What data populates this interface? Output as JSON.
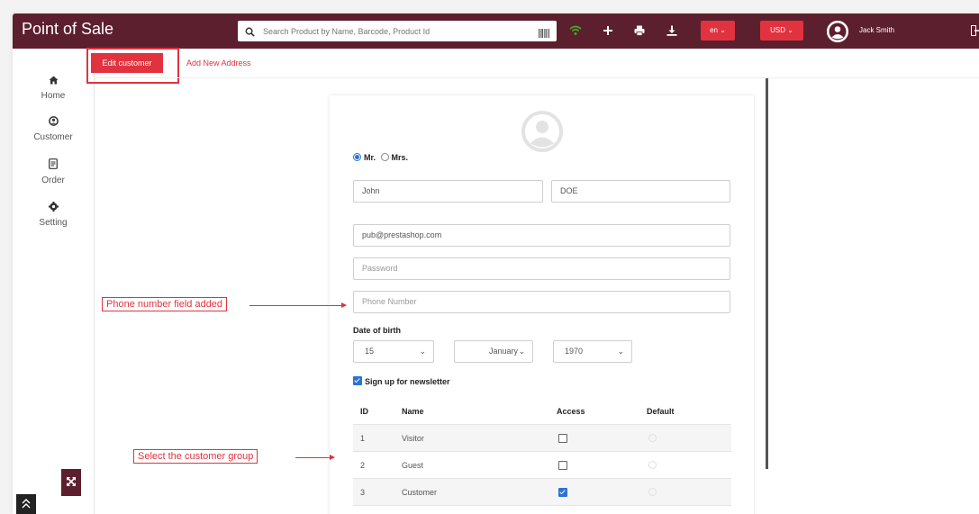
{
  "app": {
    "title": "Point of Sale"
  },
  "search": {
    "placeholder": "Search Product by Name, Barcode, Product Id"
  },
  "header": {
    "language": "en",
    "currency": "USD",
    "user_name": "Jack Smith"
  },
  "sidebar": {
    "items": [
      {
        "label": "Home",
        "icon": "home-icon"
      },
      {
        "label": "Customer",
        "icon": "user-icon"
      },
      {
        "label": "Order",
        "icon": "order-icon"
      },
      {
        "label": "Setting",
        "icon": "gear-icon"
      }
    ]
  },
  "tabs": {
    "edit": "Edit customer",
    "add_address": "Add New Address"
  },
  "form": {
    "title_options": [
      "Mr.",
      "Mrs."
    ],
    "title_selected": "Mr.",
    "first_name": "John",
    "last_name": "DOE",
    "email": "pub@prestashop.com",
    "password_placeholder": "Password",
    "phone_placeholder": "Phone Number",
    "dob_label": "Date of birth",
    "dob_day": "15",
    "dob_month": "January",
    "dob_year": "1970",
    "newsletter_label": "Sign up for newsletter",
    "newsletter_checked": true
  },
  "groups_table": {
    "headers": [
      "ID",
      "Name",
      "Access",
      "Default"
    ],
    "rows": [
      {
        "id": "1",
        "name": "Visitor",
        "access": false
      },
      {
        "id": "2",
        "name": "Guest",
        "access": false
      },
      {
        "id": "3",
        "name": "Customer",
        "access": true
      }
    ]
  },
  "annotations": {
    "phone": "Phone number field added",
    "group": "Select the customer group"
  },
  "colors": {
    "brand": "#5c1f2e",
    "accent": "#e0333f",
    "check": "#2a74d4"
  }
}
